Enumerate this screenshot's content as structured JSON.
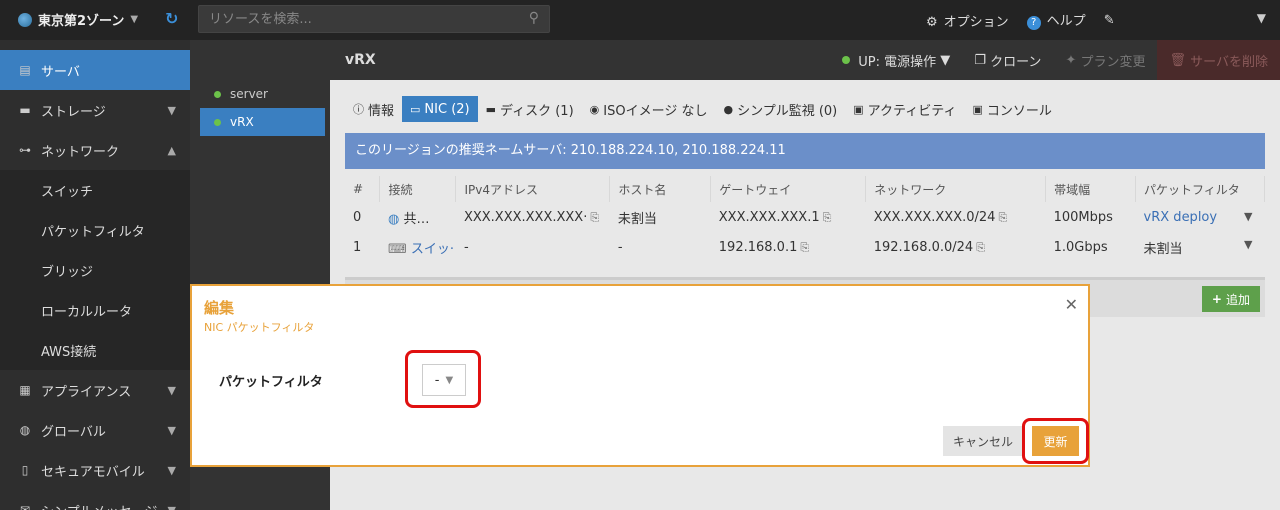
{
  "topbar": {
    "zone": "東京第2ゾーン",
    "search_placeholder": "リソースを検索...",
    "options": "オプション",
    "help": "ヘルプ"
  },
  "sidebar": {
    "items": [
      {
        "label": "サーバ"
      },
      {
        "label": "ストレージ"
      },
      {
        "label": "ネットワーク"
      },
      {
        "label": "スイッチ"
      },
      {
        "label": "パケットフィルタ"
      },
      {
        "label": "ブリッジ"
      },
      {
        "label": "ローカルルータ"
      },
      {
        "label": "AWS接続"
      },
      {
        "label": "アプライアンス"
      },
      {
        "label": "グローバル"
      },
      {
        "label": "セキュアモバイル"
      },
      {
        "label": "シンプルメッセージ"
      }
    ]
  },
  "servers": [
    {
      "name": "server"
    },
    {
      "name": "vRX"
    }
  ],
  "main": {
    "title": "vRX",
    "power": "UP: 電源操作",
    "clone": "クローン",
    "plan": "プラン変更",
    "delete": "サーバを削除",
    "tabs": [
      {
        "label": "情報"
      },
      {
        "label": "NIC (2)"
      },
      {
        "label": "ディスク (1)"
      },
      {
        "label": "ISOイメージ なし"
      },
      {
        "label": "シンプル監視 (0)"
      },
      {
        "label": "アクティビティ"
      },
      {
        "label": "コンソール"
      }
    ],
    "info": "このリージョンの推奨ネームサーバ: 210.188.224.10, 210.188.224.11",
    "columns": [
      "#",
      "接続",
      "IPv4アドレス",
      "ホスト名",
      "ゲートウェイ",
      "ネットワーク",
      "帯域幅",
      "パケットフィルタ"
    ],
    "rows": [
      {
        "num": "0",
        "conn": "共…",
        "ipv4": "XXX.XXX.XXX.XXX·",
        "host": "未割当",
        "gw": "XXX.XXX.XXX.1",
        "net": "XXX.XXX.XXX.0/24",
        "bw": "100Mbps",
        "pf": "vRX deploy"
      },
      {
        "num": "1",
        "conn": "スイッ·",
        "ipv4": "-",
        "host": "-",
        "gw": "192.168.0.1",
        "net": "192.168.0.0/24",
        "bw": "1.0Gbps",
        "pf": "未割当"
      }
    ],
    "add": "追加"
  },
  "modal": {
    "title": "編集",
    "subtitle": "NIC パケットフィルタ",
    "field_label": "パケットフィルタ",
    "select_value": "-",
    "cancel": "キャンセル",
    "update": "更新"
  }
}
